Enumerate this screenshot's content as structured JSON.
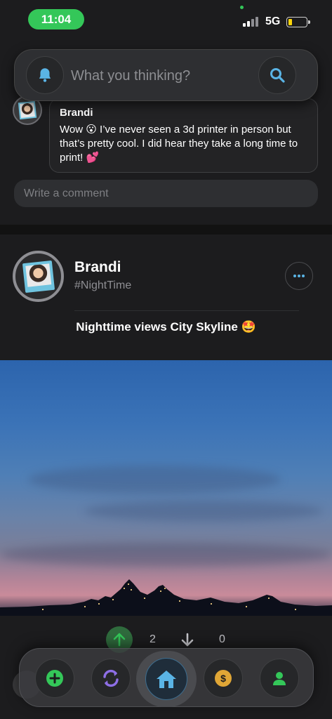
{
  "status_bar": {
    "time": "11:04",
    "network": "5G"
  },
  "search": {
    "placeholder": "What you thinking?"
  },
  "comment": {
    "author": "Brandi",
    "text": "Wow 😮 I’ve never seen a 3d printer in person but that’s pretty cool. I did hear they take a long time to print! 💕",
    "input_placeholder": "Write a comment"
  },
  "post": {
    "author": "Brandi",
    "tag": "#NightTime",
    "caption": "Nighttime views City Skyline 🤩",
    "upvotes": "2",
    "downvotes": "0"
  },
  "colors": {
    "accent_green": "#34c759",
    "accent_blue": "#5ab4e5",
    "accent_purple": "#8e6fe6",
    "accent_gold": "#e0a636",
    "background": "#1c1c1e"
  },
  "bottom_nav": {
    "items": [
      "plus-icon",
      "refresh-icon",
      "home-icon",
      "coin-icon",
      "person-icon"
    ]
  }
}
